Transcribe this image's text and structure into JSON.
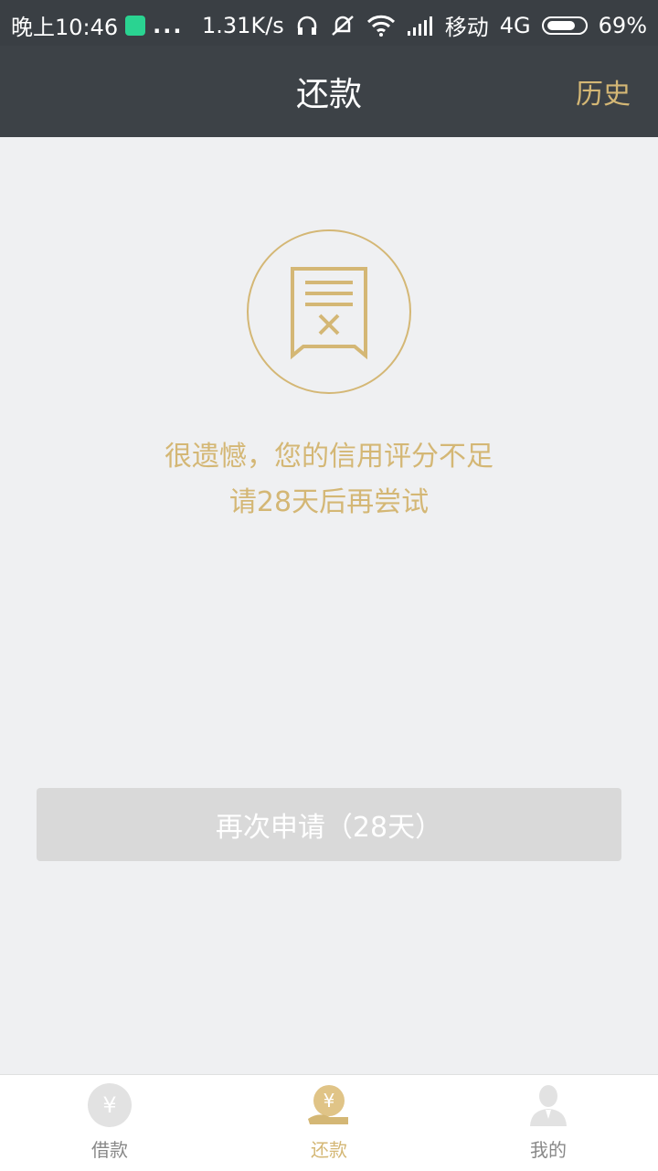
{
  "status": {
    "time": "晚上10:46",
    "dots": "...",
    "speed": "1.31K/s",
    "carrier": "移动",
    "network": "4G",
    "battery": "69%"
  },
  "nav": {
    "title": "还款",
    "history": "历史"
  },
  "message": {
    "line1": "很遗憾，您的信用评分不足",
    "line2": "请28天后再尝试"
  },
  "button": {
    "label": "再次申请（28天）"
  },
  "tabs": [
    {
      "label": "借款",
      "icon": "yen-circle-icon",
      "active": false
    },
    {
      "label": "还款",
      "icon": "hand-yen-icon",
      "active": true
    },
    {
      "label": "我的",
      "icon": "user-icon",
      "active": false
    }
  ],
  "colors": {
    "accent": "#d4b775",
    "header": "#3d4247",
    "background": "#eff0f2",
    "disabled_button": "#d9d9d9"
  }
}
